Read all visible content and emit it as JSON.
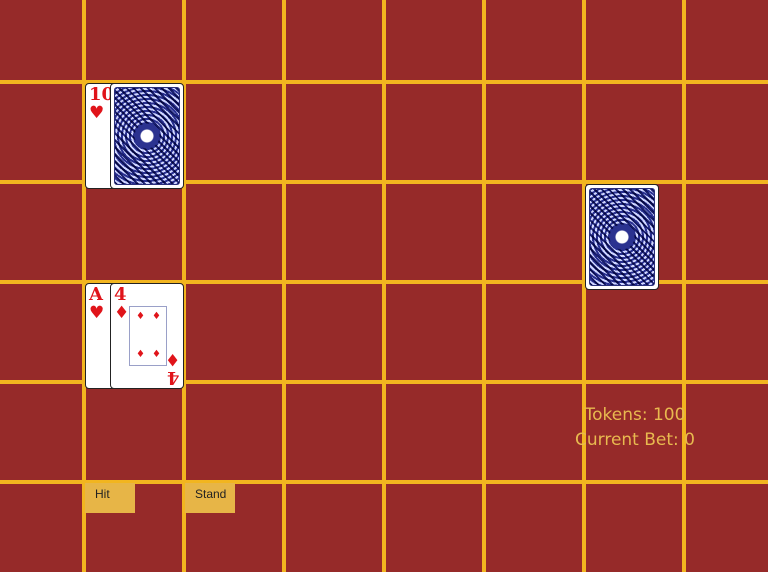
{
  "game": {
    "tokens_text": "Tokens: 100",
    "current_bet_text": "Current Bet: 0"
  },
  "dealer_hand": {
    "cards": [
      {
        "rank": "10",
        "suit": "♥",
        "face_up": true
      },
      {
        "face_up": false
      }
    ]
  },
  "deck": {
    "face_up": false
  },
  "player_hand": {
    "cards": [
      {
        "rank": "A",
        "suit": "♥",
        "face_up": true
      },
      {
        "rank": "4",
        "suit": "♦",
        "face_up": true
      }
    ]
  },
  "controls": {
    "hit_label": "Hit",
    "stand_label": "Stand"
  },
  "colors": {
    "table": "#962a29",
    "grid": "#f2b51f",
    "status_text": "#e8b94f",
    "button": "#e7b547",
    "red_suit": "#e0141a"
  }
}
